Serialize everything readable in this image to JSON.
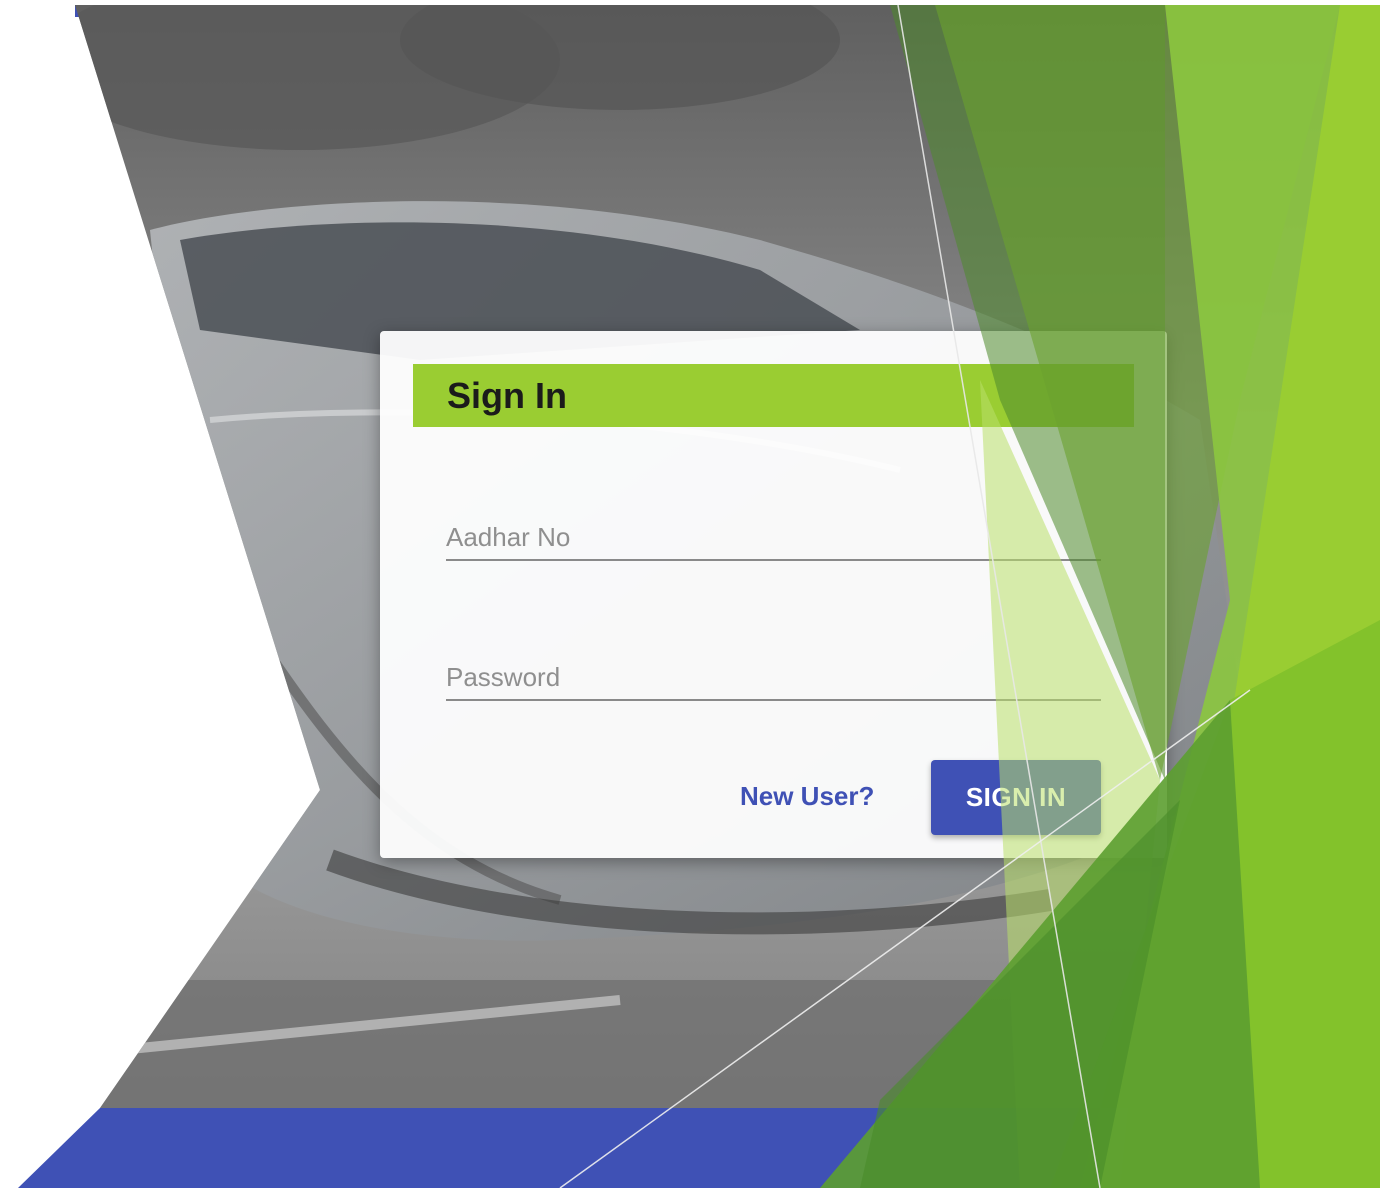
{
  "signin_card": {
    "title": "Sign In",
    "aadhar_placeholder": "Aadhar No",
    "password_placeholder": "Password",
    "new_user_link": "New User?",
    "signin_button": "SIGN IN"
  },
  "colors": {
    "accent_green": "#9acd32",
    "primary_blue": "#3f51b5"
  }
}
